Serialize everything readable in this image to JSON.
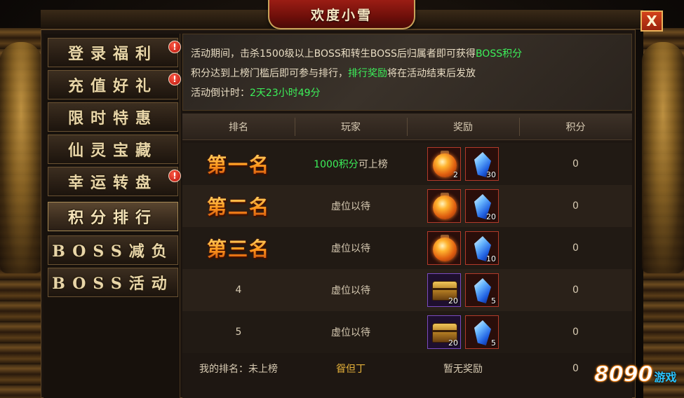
{
  "window": {
    "title": "欢度小雪",
    "close_icon": "close-x-icon",
    "close_label": "X"
  },
  "sidebar": {
    "items": [
      {
        "label": "登录福利",
        "badge": "!",
        "active": false
      },
      {
        "label": "充值好礼",
        "badge": "!",
        "active": false
      },
      {
        "label": "限时特惠",
        "badge": "",
        "active": false
      },
      {
        "label": "仙灵宝藏",
        "badge": "",
        "active": false
      },
      {
        "label": "幸运转盘",
        "badge": "!",
        "active": false
      },
      {
        "label": "积分排行",
        "badge": "",
        "active": true
      },
      {
        "label": "BOSS减负",
        "badge": "",
        "active": false
      },
      {
        "label": "BOSS活动",
        "badge": "",
        "active": false
      }
    ]
  },
  "info": {
    "line1_prefix": "活动期间，击杀1500级以上BOSS和转生BOSS后归属者即可获得",
    "line1_highlight": "BOSS积分",
    "line2_prefix": "积分达到上榜门槛后即可参与排行，",
    "line2_highlight": "排行奖励",
    "line2_suffix": "将在活动结束后发放",
    "line3_prefix": "活动倒计时：",
    "line3_highlight": "2天23小时49分"
  },
  "table": {
    "headers": [
      "排名",
      "玩家",
      "奖励",
      "积分"
    ],
    "rows": [
      {
        "rank": "第一名",
        "player_highlight": "1000积分",
        "player_suffix": "可上榜",
        "rewards": [
          {
            "icon": "potion-icon",
            "count": "2"
          },
          {
            "icon": "crystal-icon",
            "count": "30"
          }
        ],
        "score": "0"
      },
      {
        "rank": "第二名",
        "player_highlight": "",
        "player_suffix": "虚位以待",
        "rewards": [
          {
            "icon": "potion-icon",
            "count": ""
          },
          {
            "icon": "crystal-icon",
            "count": "20"
          }
        ],
        "score": "0"
      },
      {
        "rank": "第三名",
        "player_highlight": "",
        "player_suffix": "虚位以待",
        "rewards": [
          {
            "icon": "potion-icon",
            "count": ""
          },
          {
            "icon": "crystal-icon",
            "count": "10"
          }
        ],
        "score": "0"
      },
      {
        "rank": "4",
        "player_highlight": "",
        "player_suffix": "虚位以待",
        "rewards": [
          {
            "icon": "treasure-chest-icon",
            "count": "20"
          },
          {
            "icon": "crystal-icon",
            "count": "5"
          }
        ],
        "score": "0"
      },
      {
        "rank": "5",
        "player_highlight": "",
        "player_suffix": "虚位以待",
        "rewards": [
          {
            "icon": "treasure-chest-icon",
            "count": "20"
          },
          {
            "icon": "crystal-icon",
            "count": "5"
          }
        ],
        "score": "0"
      }
    ]
  },
  "footer": {
    "my_rank": "我的排名：未上榜",
    "player_name": "眢但丁",
    "reward": "暂无奖励",
    "score": "0"
  },
  "watermark": {
    "number": "8090",
    "word": "游戏"
  },
  "colors": {
    "highlight_green": "#3cf05a",
    "title_red": "#9b1d14",
    "gold": "#e6b23a"
  }
}
